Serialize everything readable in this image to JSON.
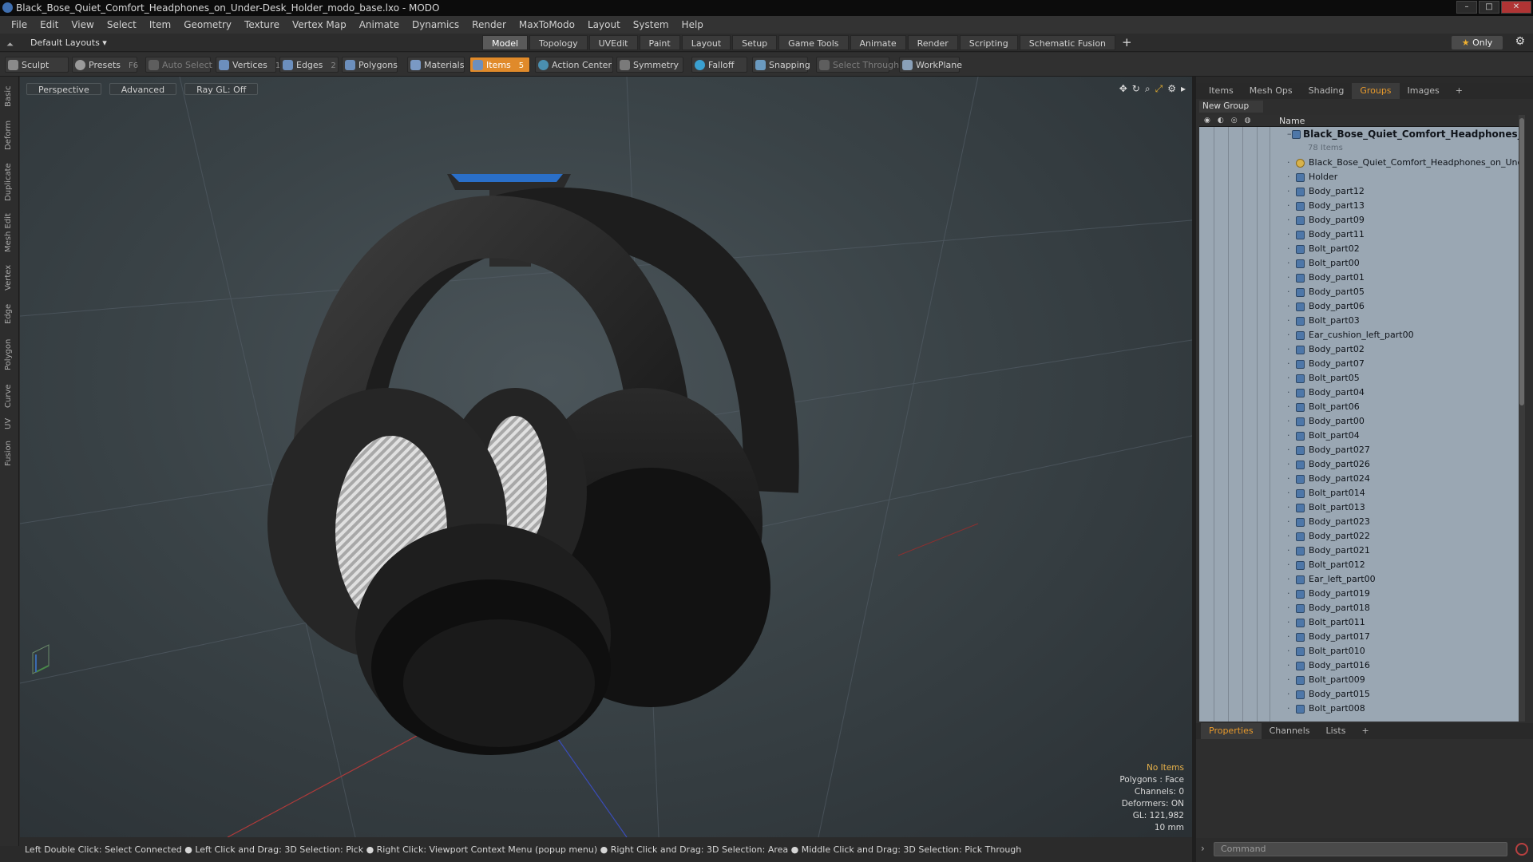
{
  "window": {
    "title": "Black_Bose_Quiet_Comfort_Headphones_on_Under-Desk_Holder_modo_base.lxo - MODO",
    "minimize": "–",
    "maximize": "□",
    "close": "✕"
  },
  "menu": [
    "File",
    "Edit",
    "View",
    "Select",
    "Item",
    "Geometry",
    "Texture",
    "Vertex Map",
    "Animate",
    "Dynamics",
    "Render",
    "MaxToModo",
    "Layout",
    "System",
    "Help"
  ],
  "layouts": {
    "label": "Default Layouts ▾",
    "icon": "arrow-up-icon"
  },
  "tabs": [
    "Model",
    "Topology",
    "UVEdit",
    "Paint",
    "Layout",
    "Setup",
    "Game Tools",
    "Animate",
    "Render",
    "Scripting",
    "Schematic Fusion"
  ],
  "tabs_active": "Model",
  "only_button": "Only",
  "toolbar": {
    "sculpt": "Sculpt",
    "presets": "Presets",
    "presets_key": "F6",
    "auto_select": "Auto Select",
    "vertices": "Vertices",
    "vertices_key": "1",
    "edges": "Edges",
    "edges_key": "2",
    "polygons": "Polygons",
    "materials": "Materials",
    "items": "Items",
    "items_key": "5",
    "action_center": "Action Center",
    "symmetry": "Symmetry",
    "falloff": "Falloff",
    "snapping": "Snapping",
    "select_through": "Select Through",
    "workplane": "WorkPlane"
  },
  "left_tabs": [
    "Basic",
    "Deform",
    "Duplicate",
    "Mesh Edit",
    "Vertex",
    "Edge",
    "Polygon",
    "Curve",
    "UV",
    "Fusion"
  ],
  "viewport": {
    "perspective": "Perspective",
    "advanced": "Advanced",
    "raygl": "Ray GL: Off"
  },
  "viewport_info": {
    "no_items": "No Items",
    "polygons": "Polygons : Face",
    "channels": "Channels: 0",
    "deformers": "Deformers: ON",
    "gl": "GL: 121,982",
    "scale": "10 mm"
  },
  "status": "Left Double Click: Select Connected ● Left Click and Drag: 3D Selection: Pick ● Right Click: Viewport Context Menu (popup menu) ● Right Click and Drag: 3D Selection: Area ● Middle Click and Drag: 3D Selection: Pick Through",
  "panel_tabs": [
    "Items",
    "Mesh Ops",
    "Shading",
    "Groups",
    "Images",
    "+"
  ],
  "panel_active": "Groups",
  "new_group": "New Group",
  "list_header": "Name",
  "root_item": "Black_Bose_Quiet_Comfort_Headphones_on_...",
  "root_count": "78 Items",
  "locator_item": "Black_Bose_Quiet_Comfort_Headphones_on_Unde ...",
  "items": [
    "Holder",
    "Body_part12",
    "Body_part13",
    "Body_part09",
    "Body_part11",
    "Bolt_part02",
    "Bolt_part00",
    "Body_part01",
    "Body_part05",
    "Body_part06",
    "Bolt_part03",
    "Ear_cushion_left_part00",
    "Body_part02",
    "Body_part07",
    "Bolt_part05",
    "Body_part04",
    "Bolt_part06",
    "Body_part00",
    "Bolt_part04",
    "Body_part027",
    "Body_part026",
    "Body_part024",
    "Bolt_part014",
    "Bolt_part013",
    "Body_part023",
    "Body_part022",
    "Body_part021",
    "Bolt_part012",
    "Ear_left_part00",
    "Body_part019",
    "Body_part018",
    "Bolt_part011",
    "Body_part017",
    "Bolt_part010",
    "Body_part016",
    "Bolt_part009",
    "Body_part015",
    "Bolt_part008"
  ],
  "prop_tabs": [
    "Properties",
    "Channels",
    "Lists",
    "+"
  ],
  "prop_active": "Properties",
  "command_placeholder": "Command"
}
